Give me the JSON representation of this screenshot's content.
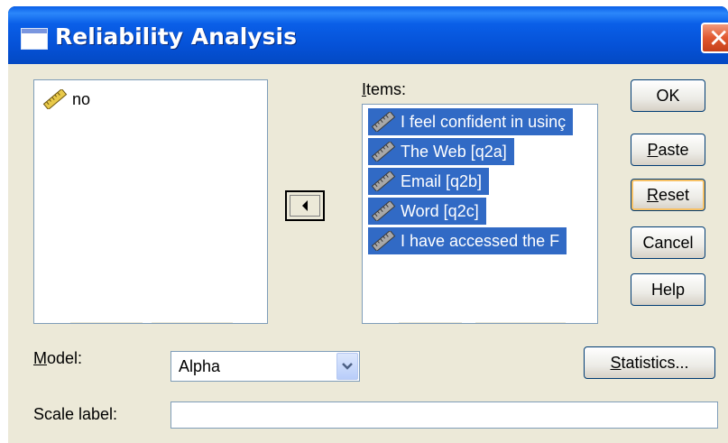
{
  "window": {
    "title": "Reliability Analysis",
    "close_glyph": "✕"
  },
  "source_list": {
    "items": [
      {
        "label": "no",
        "icon": "ruler-icon"
      }
    ]
  },
  "items_list": {
    "label_first": "I",
    "label_rest": "tems:",
    "items": [
      {
        "label": "I feel confident in usinç",
        "icon": "ruler-icon",
        "selected": true
      },
      {
        "label": "The Web [q2a]",
        "icon": "ruler-icon",
        "selected": true
      },
      {
        "label": "Email [q2b]",
        "icon": "ruler-icon",
        "selected": true
      },
      {
        "label": "Word  [q2c]",
        "icon": "ruler-icon",
        "selected": true
      },
      {
        "label": "I have accessed the F",
        "icon": "ruler-icon",
        "selected": true
      }
    ]
  },
  "buttons": {
    "ok": "OK",
    "paste_first": "P",
    "paste_rest": "aste",
    "reset_first": "R",
    "reset_rest": "eset",
    "cancel": "Cancel",
    "help": "Help",
    "statistics_first": "S",
    "statistics_rest": "tatistics..."
  },
  "model": {
    "label_first": "M",
    "label_rest": "odel:",
    "value": "Alpha"
  },
  "scale_label": {
    "label": "Scale label:",
    "value": ""
  },
  "colors": {
    "selection": "#316ac5",
    "dialog_bg": "#ece9d8",
    "title_bar": "#0a5fe8"
  }
}
